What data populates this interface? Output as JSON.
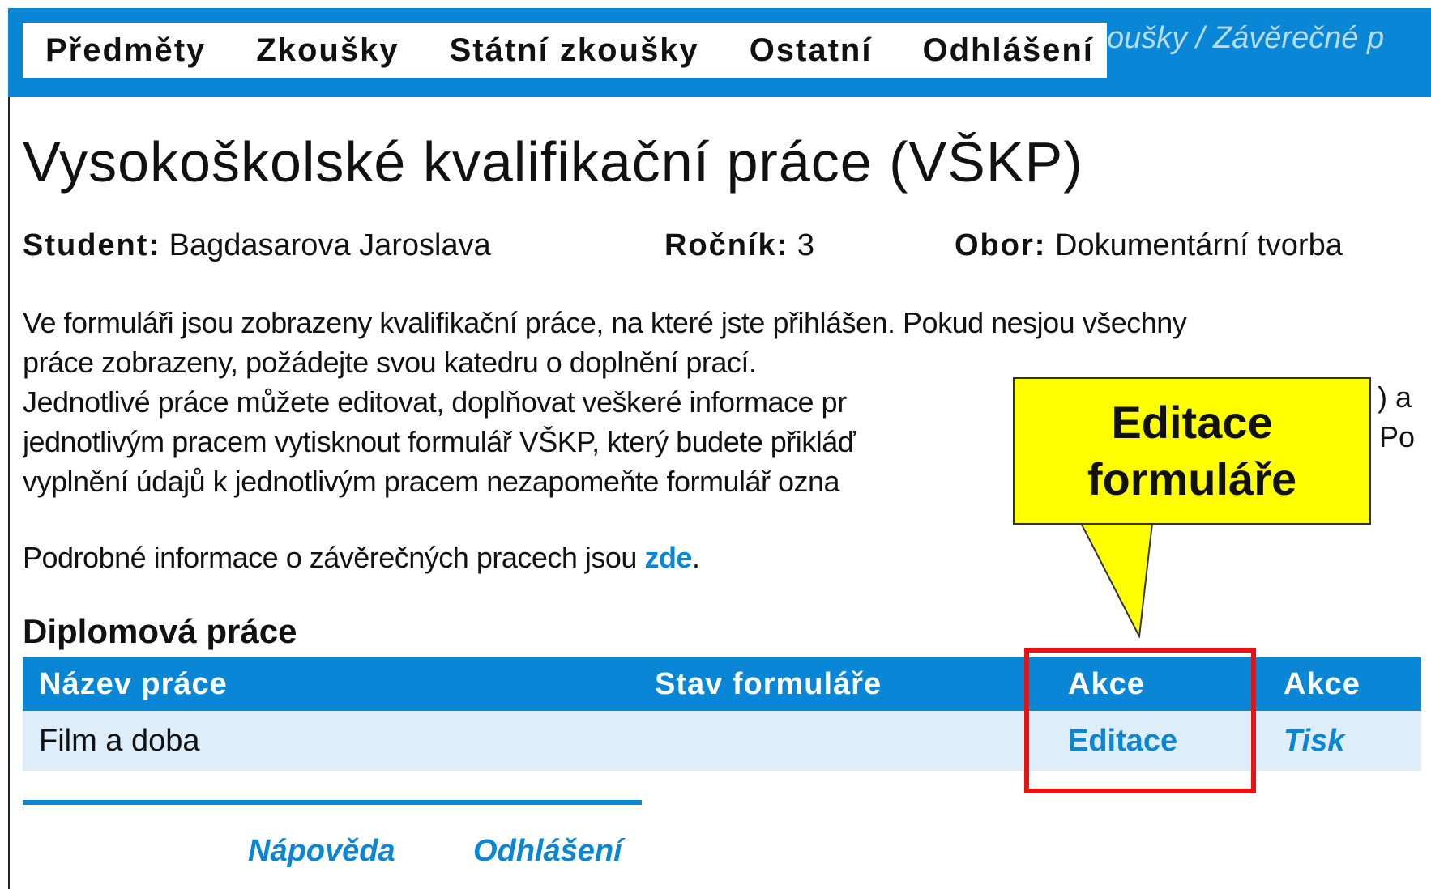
{
  "nav": {
    "items": [
      {
        "label": "Předměty"
      },
      {
        "label": "Zkoušky"
      },
      {
        "label": "Státní zkoušky"
      },
      {
        "label": "Ostatní"
      },
      {
        "label": "Odhlášení"
      }
    ],
    "breadcrumb": "oušky / Závěrečné p"
  },
  "page": {
    "title": "Vysokoškolské kvalifikační práce (VŠKP)"
  },
  "student": {
    "student_label": "Student:",
    "student_value": "Bagdasarova Jaroslava",
    "year_label": "Ročník:",
    "year_value": "3",
    "field_label": "Obor:",
    "field_value": "Dokumentární tvorba"
  },
  "intro": {
    "lines": [
      "Ve formuláři jsou zobrazeny kvalifikační práce, na které jste přihlášen. Pokud nesjou všechny",
      "práce zobrazeny, požádejte svou katedru o doplnění prací.",
      "Jednotlivé práce můžete editovat, doplňovat veškeré informace pr",
      "jednotlivým pracem vytisknout formulář VŠKP, který budete přikláď",
      "vyplnění údajů k jednotlivým pracem nezapomeňte formulář ozna"
    ],
    "line3_tail": ") a",
    "line4_tail": "Po",
    "more_text": "Podrobné informace o závěrečných pracech jsou ",
    "more_link": "zde",
    "more_end": "."
  },
  "section": {
    "title": "Diplomová práce"
  },
  "table": {
    "headers": [
      "Název práce",
      "Stav formuláře",
      "Akce",
      "Akce"
    ],
    "rows": [
      {
        "name": "Film a doba",
        "status": "",
        "edit": "Editace",
        "print": "Tisk"
      }
    ]
  },
  "footer": {
    "help": "Nápověda",
    "logout": "Odhlášení"
  },
  "callout": {
    "line1": "Editace",
    "line2": "formuláře"
  },
  "colors": {
    "accent": "#0a86d6",
    "row_bg": "#ddeefa",
    "callout": "#ffff00",
    "highlight": "#ee1111"
  }
}
